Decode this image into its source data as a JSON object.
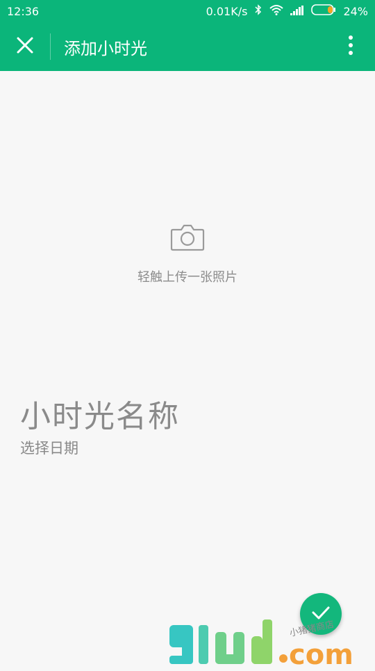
{
  "status_bar": {
    "time": "12:36",
    "network_speed": "0.01K/s",
    "battery_percent": "24%",
    "icons": [
      "bluetooth-icon",
      "wifi-icon",
      "signal-icon",
      "battery-icon"
    ]
  },
  "toolbar": {
    "title": "添加小时光",
    "close_icon": "close-icon",
    "more_icon": "more-vertical-icon",
    "color": "#0bb57a"
  },
  "photo": {
    "icon": "camera-icon",
    "hint": "轻触上传一张照片"
  },
  "moment": {
    "name_placeholder": "小时光名称",
    "date_placeholder": "选择日期"
  },
  "fab": {
    "icon": "check-icon"
  },
  "watermark": {
    "logo_text": "91ud.com",
    "tagline": "小猪猪商店"
  }
}
